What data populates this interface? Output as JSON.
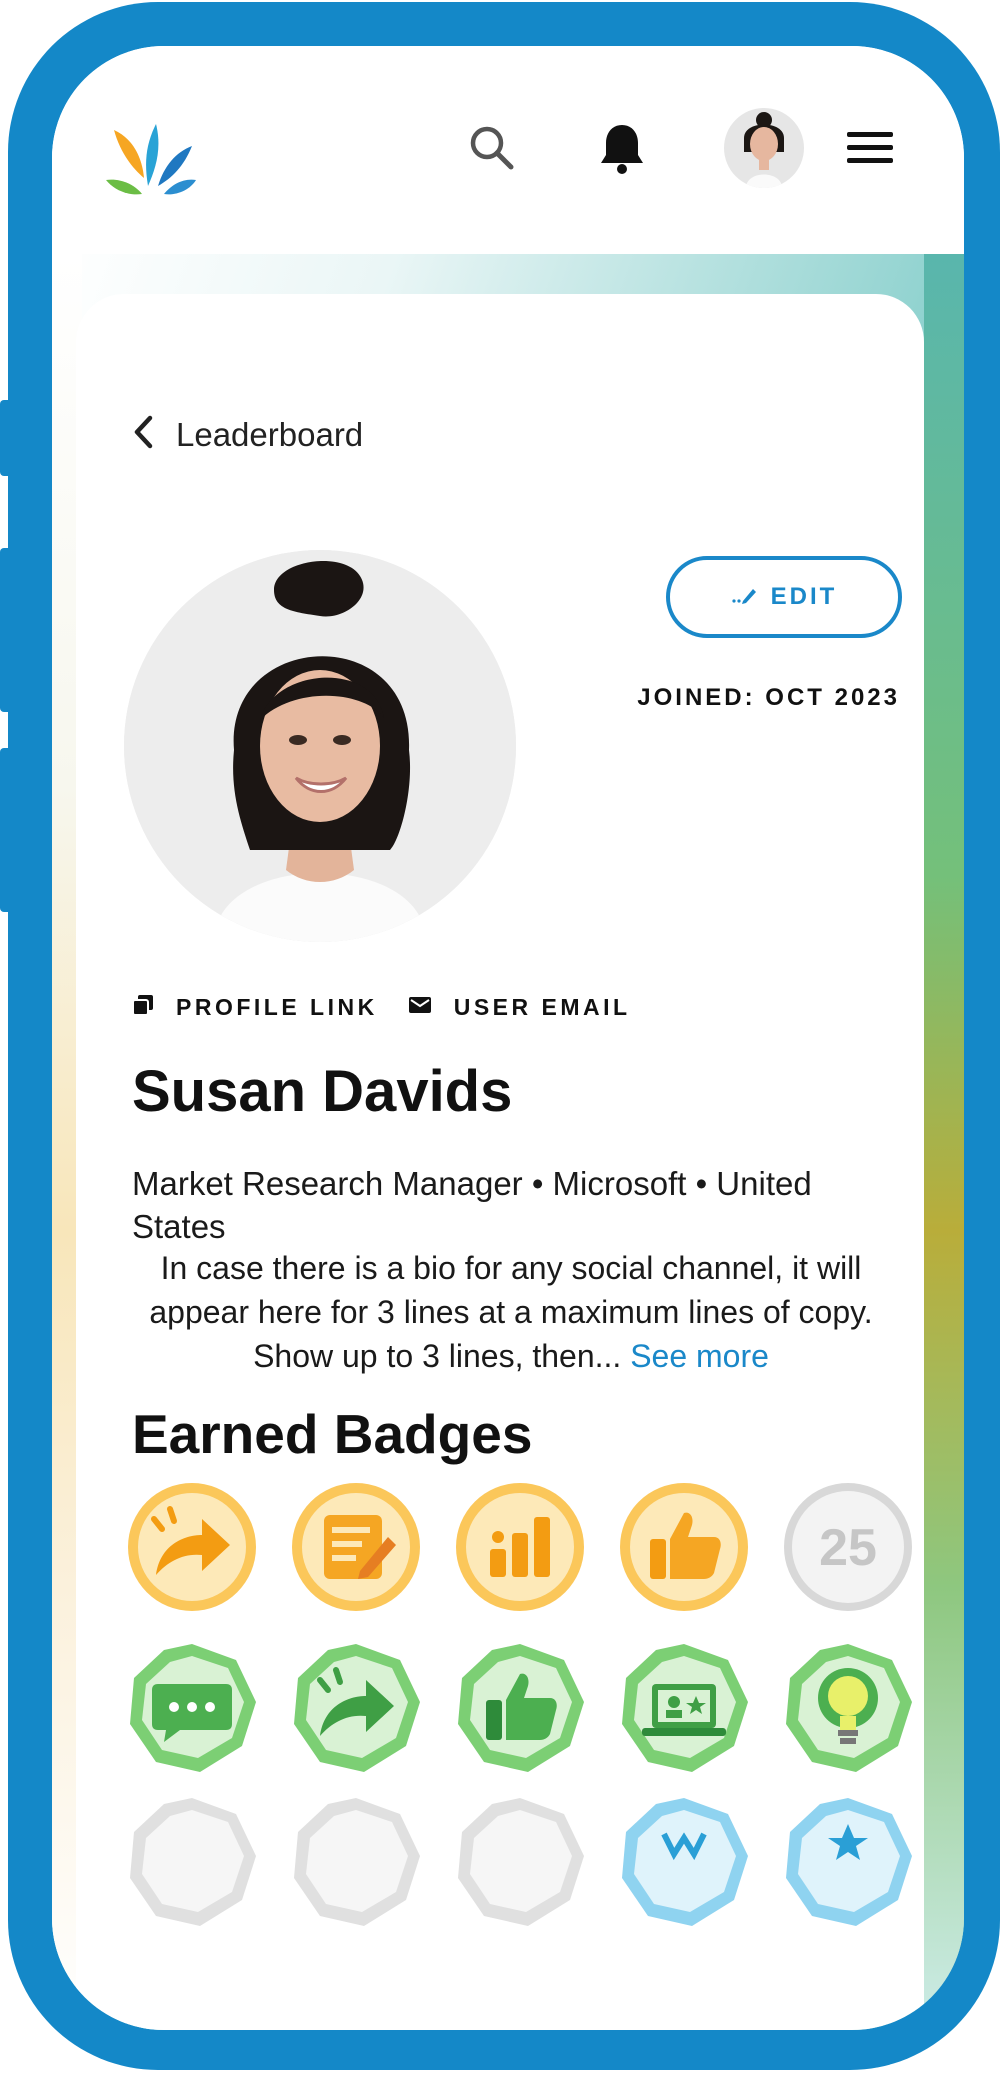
{
  "topbar": {
    "logo_icon": "brand-logo-icon",
    "search_icon": "search-icon",
    "notification_icon": "bell-icon",
    "avatar_icon": "user-avatar",
    "menu_icon": "hamburger-menu-icon"
  },
  "nav": {
    "back_label": "Leaderboard"
  },
  "profile": {
    "edit_label": "EDIT",
    "joined": "JOINED: OCT 2023",
    "profile_link_label": "PROFILE LINK",
    "user_email_label": "USER EMAIL",
    "name": "Susan Davids",
    "meta_line": "Market Research Manager • Microsoft • United States",
    "bio": "In case there is a bio for any social channel, it will appear here for 3 lines at a maximum lines of copy. Show up to 3 lines, then...",
    "see_more": "See more"
  },
  "badges": {
    "title": "Earned Badges",
    "row1": [
      {
        "icon": "share-arrow-badge-icon",
        "tier": "gold"
      },
      {
        "icon": "notepad-write-badge-icon",
        "tier": "gold"
      },
      {
        "icon": "bar-chart-badge-icon",
        "tier": "gold"
      },
      {
        "icon": "thumbs-up-badge-icon",
        "tier": "gold"
      },
      {
        "icon": "count-25-badge-icon",
        "tier": "locked",
        "label": "25"
      }
    ],
    "row2": [
      {
        "icon": "chat-badge-icon",
        "tier": "green"
      },
      {
        "icon": "share-arrow-badge-icon",
        "tier": "green"
      },
      {
        "icon": "thumbs-up-badge-icon",
        "tier": "green"
      },
      {
        "icon": "laptop-star-badge-icon",
        "tier": "green"
      },
      {
        "icon": "lightbulb-badge-icon",
        "tier": "green"
      }
    ]
  },
  "colors": {
    "frame": "#1488c8",
    "accent": "#1a88c9",
    "gold_badge": "#f7a21b",
    "green_badge": "#5cb85c",
    "locked_badge": "#cfcfcf"
  }
}
